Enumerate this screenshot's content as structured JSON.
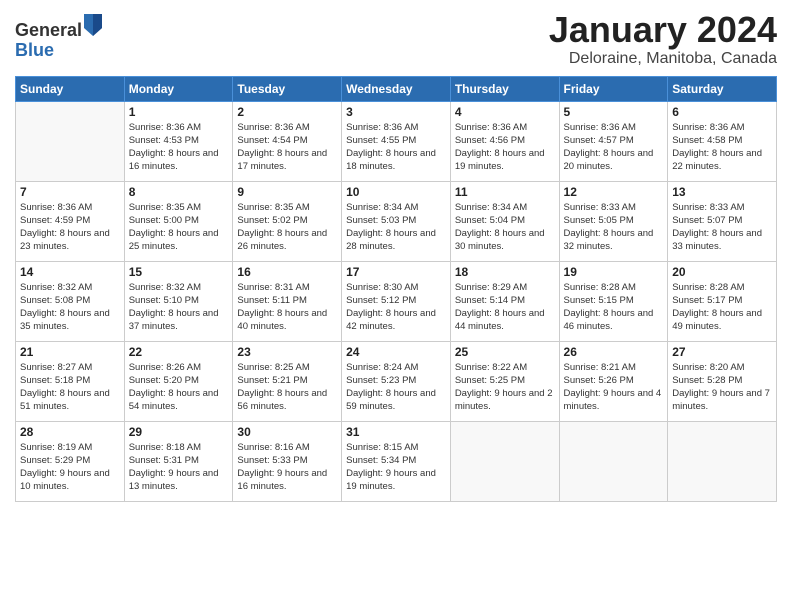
{
  "logo": {
    "general": "General",
    "blue": "Blue"
  },
  "header": {
    "month_title": "January 2024",
    "location": "Deloraine, Manitoba, Canada"
  },
  "weekdays": [
    "Sunday",
    "Monday",
    "Tuesday",
    "Wednesday",
    "Thursday",
    "Friday",
    "Saturday"
  ],
  "weeks": [
    [
      {
        "day": "",
        "sunrise": "",
        "sunset": "",
        "daylight": ""
      },
      {
        "day": "1",
        "sunrise": "Sunrise: 8:36 AM",
        "sunset": "Sunset: 4:53 PM",
        "daylight": "Daylight: 8 hours and 16 minutes."
      },
      {
        "day": "2",
        "sunrise": "Sunrise: 8:36 AM",
        "sunset": "Sunset: 4:54 PM",
        "daylight": "Daylight: 8 hours and 17 minutes."
      },
      {
        "day": "3",
        "sunrise": "Sunrise: 8:36 AM",
        "sunset": "Sunset: 4:55 PM",
        "daylight": "Daylight: 8 hours and 18 minutes."
      },
      {
        "day": "4",
        "sunrise": "Sunrise: 8:36 AM",
        "sunset": "Sunset: 4:56 PM",
        "daylight": "Daylight: 8 hours and 19 minutes."
      },
      {
        "day": "5",
        "sunrise": "Sunrise: 8:36 AM",
        "sunset": "Sunset: 4:57 PM",
        "daylight": "Daylight: 8 hours and 20 minutes."
      },
      {
        "day": "6",
        "sunrise": "Sunrise: 8:36 AM",
        "sunset": "Sunset: 4:58 PM",
        "daylight": "Daylight: 8 hours and 22 minutes."
      }
    ],
    [
      {
        "day": "7",
        "sunrise": "Sunrise: 8:36 AM",
        "sunset": "Sunset: 4:59 PM",
        "daylight": "Daylight: 8 hours and 23 minutes."
      },
      {
        "day": "8",
        "sunrise": "Sunrise: 8:35 AM",
        "sunset": "Sunset: 5:00 PM",
        "daylight": "Daylight: 8 hours and 25 minutes."
      },
      {
        "day": "9",
        "sunrise": "Sunrise: 8:35 AM",
        "sunset": "Sunset: 5:02 PM",
        "daylight": "Daylight: 8 hours and 26 minutes."
      },
      {
        "day": "10",
        "sunrise": "Sunrise: 8:34 AM",
        "sunset": "Sunset: 5:03 PM",
        "daylight": "Daylight: 8 hours and 28 minutes."
      },
      {
        "day": "11",
        "sunrise": "Sunrise: 8:34 AM",
        "sunset": "Sunset: 5:04 PM",
        "daylight": "Daylight: 8 hours and 30 minutes."
      },
      {
        "day": "12",
        "sunrise": "Sunrise: 8:33 AM",
        "sunset": "Sunset: 5:05 PM",
        "daylight": "Daylight: 8 hours and 32 minutes."
      },
      {
        "day": "13",
        "sunrise": "Sunrise: 8:33 AM",
        "sunset": "Sunset: 5:07 PM",
        "daylight": "Daylight: 8 hours and 33 minutes."
      }
    ],
    [
      {
        "day": "14",
        "sunrise": "Sunrise: 8:32 AM",
        "sunset": "Sunset: 5:08 PM",
        "daylight": "Daylight: 8 hours and 35 minutes."
      },
      {
        "day": "15",
        "sunrise": "Sunrise: 8:32 AM",
        "sunset": "Sunset: 5:10 PM",
        "daylight": "Daylight: 8 hours and 37 minutes."
      },
      {
        "day": "16",
        "sunrise": "Sunrise: 8:31 AM",
        "sunset": "Sunset: 5:11 PM",
        "daylight": "Daylight: 8 hours and 40 minutes."
      },
      {
        "day": "17",
        "sunrise": "Sunrise: 8:30 AM",
        "sunset": "Sunset: 5:12 PM",
        "daylight": "Daylight: 8 hours and 42 minutes."
      },
      {
        "day": "18",
        "sunrise": "Sunrise: 8:29 AM",
        "sunset": "Sunset: 5:14 PM",
        "daylight": "Daylight: 8 hours and 44 minutes."
      },
      {
        "day": "19",
        "sunrise": "Sunrise: 8:28 AM",
        "sunset": "Sunset: 5:15 PM",
        "daylight": "Daylight: 8 hours and 46 minutes."
      },
      {
        "day": "20",
        "sunrise": "Sunrise: 8:28 AM",
        "sunset": "Sunset: 5:17 PM",
        "daylight": "Daylight: 8 hours and 49 minutes."
      }
    ],
    [
      {
        "day": "21",
        "sunrise": "Sunrise: 8:27 AM",
        "sunset": "Sunset: 5:18 PM",
        "daylight": "Daylight: 8 hours and 51 minutes."
      },
      {
        "day": "22",
        "sunrise": "Sunrise: 8:26 AM",
        "sunset": "Sunset: 5:20 PM",
        "daylight": "Daylight: 8 hours and 54 minutes."
      },
      {
        "day": "23",
        "sunrise": "Sunrise: 8:25 AM",
        "sunset": "Sunset: 5:21 PM",
        "daylight": "Daylight: 8 hours and 56 minutes."
      },
      {
        "day": "24",
        "sunrise": "Sunrise: 8:24 AM",
        "sunset": "Sunset: 5:23 PM",
        "daylight": "Daylight: 8 hours and 59 minutes."
      },
      {
        "day": "25",
        "sunrise": "Sunrise: 8:22 AM",
        "sunset": "Sunset: 5:25 PM",
        "daylight": "Daylight: 9 hours and 2 minutes."
      },
      {
        "day": "26",
        "sunrise": "Sunrise: 8:21 AM",
        "sunset": "Sunset: 5:26 PM",
        "daylight": "Daylight: 9 hours and 4 minutes."
      },
      {
        "day": "27",
        "sunrise": "Sunrise: 8:20 AM",
        "sunset": "Sunset: 5:28 PM",
        "daylight": "Daylight: 9 hours and 7 minutes."
      }
    ],
    [
      {
        "day": "28",
        "sunrise": "Sunrise: 8:19 AM",
        "sunset": "Sunset: 5:29 PM",
        "daylight": "Daylight: 9 hours and 10 minutes."
      },
      {
        "day": "29",
        "sunrise": "Sunrise: 8:18 AM",
        "sunset": "Sunset: 5:31 PM",
        "daylight": "Daylight: 9 hours and 13 minutes."
      },
      {
        "day": "30",
        "sunrise": "Sunrise: 8:16 AM",
        "sunset": "Sunset: 5:33 PM",
        "daylight": "Daylight: 9 hours and 16 minutes."
      },
      {
        "day": "31",
        "sunrise": "Sunrise: 8:15 AM",
        "sunset": "Sunset: 5:34 PM",
        "daylight": "Daylight: 9 hours and 19 minutes."
      },
      {
        "day": "",
        "sunrise": "",
        "sunset": "",
        "daylight": ""
      },
      {
        "day": "",
        "sunrise": "",
        "sunset": "",
        "daylight": ""
      },
      {
        "day": "",
        "sunrise": "",
        "sunset": "",
        "daylight": ""
      }
    ]
  ]
}
